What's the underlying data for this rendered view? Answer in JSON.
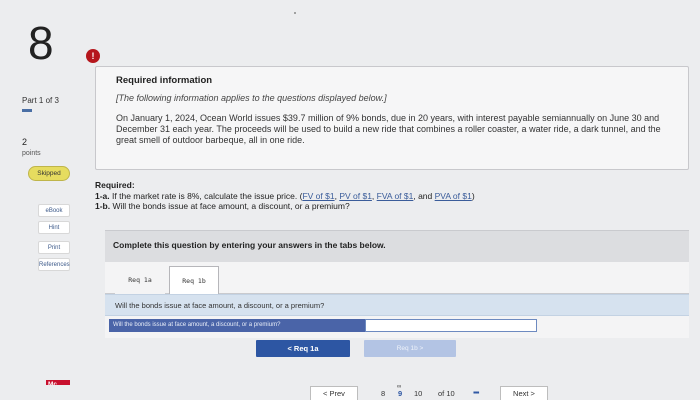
{
  "question": {
    "number": "8"
  },
  "sidebar": {
    "part": "Part 1 of 3",
    "points_value": "2",
    "points_label": "points",
    "status": "Skipped",
    "links": [
      {
        "label": "eBook"
      },
      {
        "label": "Hint"
      },
      {
        "label": "Print"
      },
      {
        "label": "References"
      }
    ],
    "logo_text": "Mc Graw Hill"
  },
  "info": {
    "alert_icon": "!",
    "title": "Required information",
    "subtitle": "[The following information applies to the questions displayed below.]",
    "body": "On January 1, 2024, Ocean World issues $39.7 million of 9% bonds, due in 20 years, with interest payable semiannually on June 30 and December 31 each year. The proceeds will be used to build a new ride that combines a roller coaster, a water ride, a dark tunnel, and the great smell of outdoor barbeque, all in one ride."
  },
  "required": {
    "heading": "Required:",
    "items": [
      {
        "num": "1-a.",
        "text": "If the market rate is 8%, calculate the issue price.",
        "links": [
          "FV of $1",
          "PV of $1",
          "FVA of $1",
          "PVA of $1"
        ]
      },
      {
        "num": "1-b.",
        "text": "Will the bonds issue at face amount, a discount, or a premium?"
      }
    ]
  },
  "panel": {
    "instruction": "Complete this question by entering your answers in the tabs below."
  },
  "tabs": [
    {
      "label": "Req 1a"
    },
    {
      "label": "Req 1b"
    }
  ],
  "question_prompt": "Will the bonds issue at face amount, a discount, or a premium?",
  "answer": {
    "label": "Will the bonds issue at face amount, a discount, or a premium?",
    "value": ""
  },
  "nav_buttons": {
    "prev_req": "< Req 1a",
    "next_req": "Req 1b >"
  },
  "footer": {
    "prev": "< Prev",
    "page_prev": "8",
    "page_current": "9",
    "page_next": "10",
    "of_label": "of 10",
    "next": "Next >"
  }
}
